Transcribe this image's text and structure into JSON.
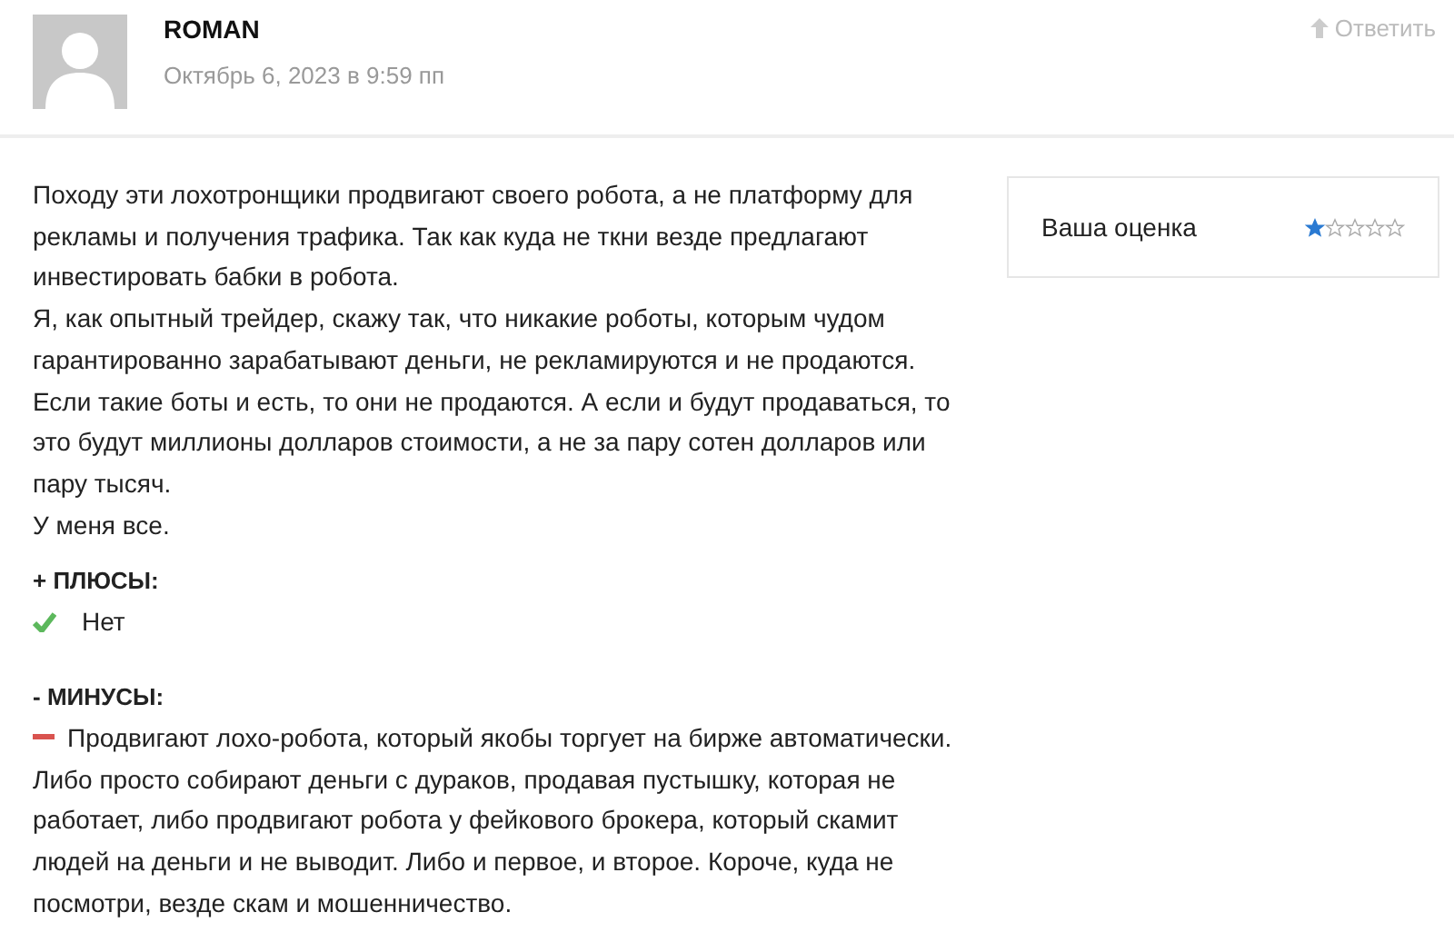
{
  "comment": {
    "author": "ROMAN",
    "date": "Октябрь 6, 2023 в 9:59 пп",
    "reply": "Ответить"
  },
  "body": [
    "Походу эти лохотронщики продвигают своего робота, а не платформу для рекламы и получения трафика. Так как куда не ткни везде предлагают инвестировать бабки в робота.",
    "Я, как опытный трейдер, скажу так, что никакие роботы, которым чудом гарантированно зарабатывают деньги, не рекламируются и не продаются. Если такие боты и есть, то они не продаются. А если и будут продаваться, то это будут миллионы долларов стоимости, а не за пару сотен долларов или пару тысяч.",
    "У меня все."
  ],
  "rating": {
    "label": "Ваша оценка",
    "stars": 1
  },
  "sections": [
    {
      "kind": "pros",
      "title": "+ ПЛЮСЫ:",
      "items": [
        "Нет"
      ]
    },
    {
      "kind": "cons",
      "title": "- МИНУСЫ:",
      "items": [
        "Продвигают лохо-робота, который якобы торгует на бирже автоматически. Либо просто собирают деньги с дураков, продавая пустышку, которая не работает, либо продвигают робота у фейкового брокера, который скамит людей на деньги и не выводит. Либо и первое, и второе. Короче, куда не посмотри, везде скам и мошенничество."
      ]
    }
  ]
}
